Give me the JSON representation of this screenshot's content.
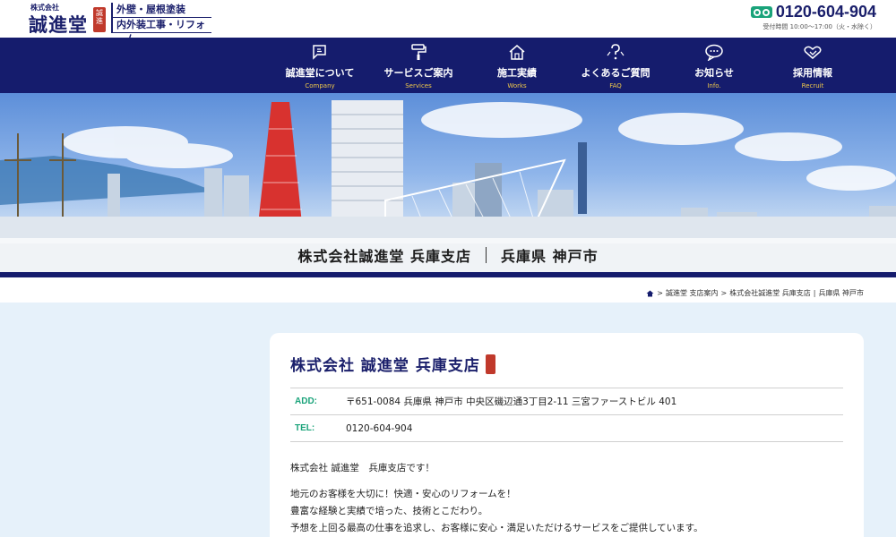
{
  "header": {
    "logo": {
      "corp": "株式会社",
      "name": "誠進堂",
      "seal_text": "誠進"
    },
    "tagline": [
      "外壁・屋根塗装",
      "内外装工事・リフォーム"
    ],
    "phone": {
      "number": "0120-604-904",
      "hours": "受付時間 10:00〜17:00（火・水除く）",
      "icon": "freedial-icon"
    }
  },
  "nav": [
    {
      "label": "誠進堂について",
      "sub": "Company",
      "icon": "flag-icon"
    },
    {
      "label": "サービスご案内",
      "sub": "Services",
      "icon": "paint-roller-icon"
    },
    {
      "label": "施工実績",
      "sub": "Works",
      "icon": "house-icon"
    },
    {
      "label": "よくあるご質問",
      "sub": "FAQ",
      "icon": "question-icon"
    },
    {
      "label": "お知らせ",
      "sub": "Info.",
      "icon": "speech-bubble-icon"
    },
    {
      "label": "採用情報",
      "sub": "Recruit",
      "icon": "handshake-icon"
    }
  ],
  "hero": {
    "title": "株式会社誠進堂 兵庫支店",
    "location": "兵庫県 神戸市"
  },
  "breadcrumb": [
    "誠進堂 支店案内",
    "株式会社誠進堂 兵庫支店",
    "兵庫県 神戸市"
  ],
  "card": {
    "title": "株式会社 誠進堂 兵庫支店",
    "rows": [
      {
        "key": "ADD:",
        "value": "〒651-0084 兵庫県 神戸市 中央区磯辺通3丁目2-11 三宮ファーストビル 401"
      },
      {
        "key": "TEL:",
        "value": "0120-604-904"
      }
    ],
    "intro": "株式会社 誠進堂　兵庫支店です！",
    "lines": [
      "地元のお客様を大切に！快適・安心のリフォームを！",
      "豊富な経験と実績で培った、技術とこだわり。",
      "予想を上回る最高の仕事を追求し、お客様に安心・満足いただけるサービスをご提供しています。"
    ]
  },
  "colors": {
    "navy": "#151c6d",
    "accent_green": "#1aa37a",
    "accent_gold": "#f0c94a",
    "seal_red": "#c0392b",
    "content_bg": "#e6f1fa"
  }
}
